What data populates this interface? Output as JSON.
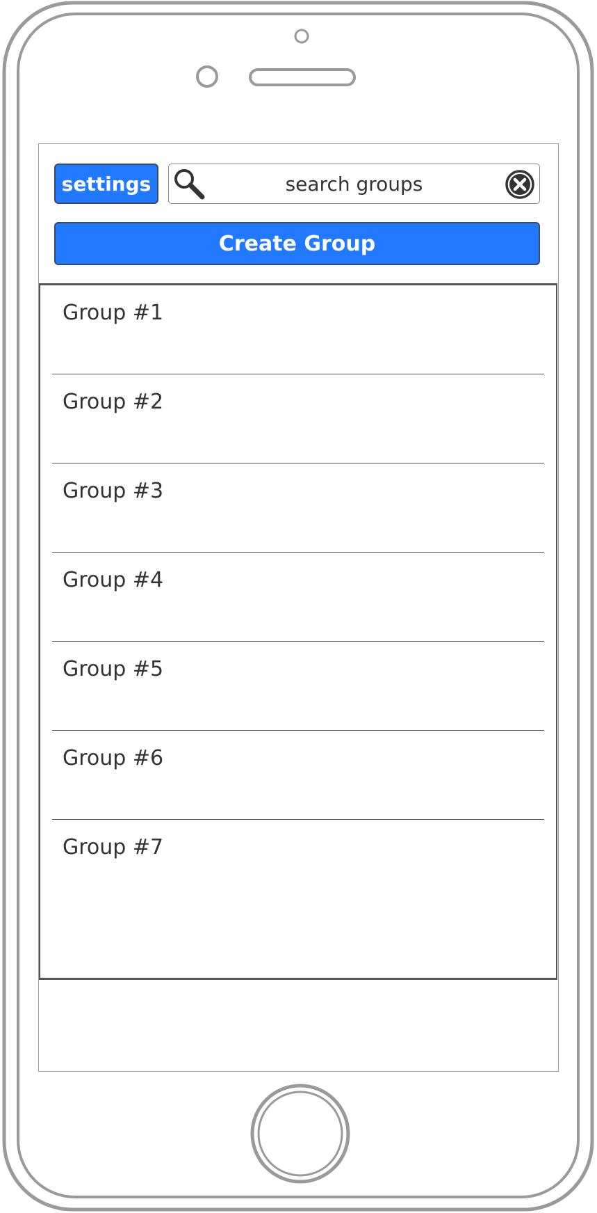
{
  "header": {
    "settings_label": "settings",
    "search_placeholder": "search groups",
    "create_label": "Create Group"
  },
  "groups": [
    {
      "label": "Group #1"
    },
    {
      "label": "Group #2"
    },
    {
      "label": "Group #3"
    },
    {
      "label": "Group #4"
    },
    {
      "label": "Group #5"
    },
    {
      "label": "Group #6"
    },
    {
      "label": "Group #7"
    }
  ],
  "colors": {
    "accent": "#2079ff",
    "text": "#333333",
    "frame": "#9a9a9a"
  },
  "icons": {
    "search": "search-icon",
    "clear": "close-circle-icon",
    "home": "home-button"
  }
}
